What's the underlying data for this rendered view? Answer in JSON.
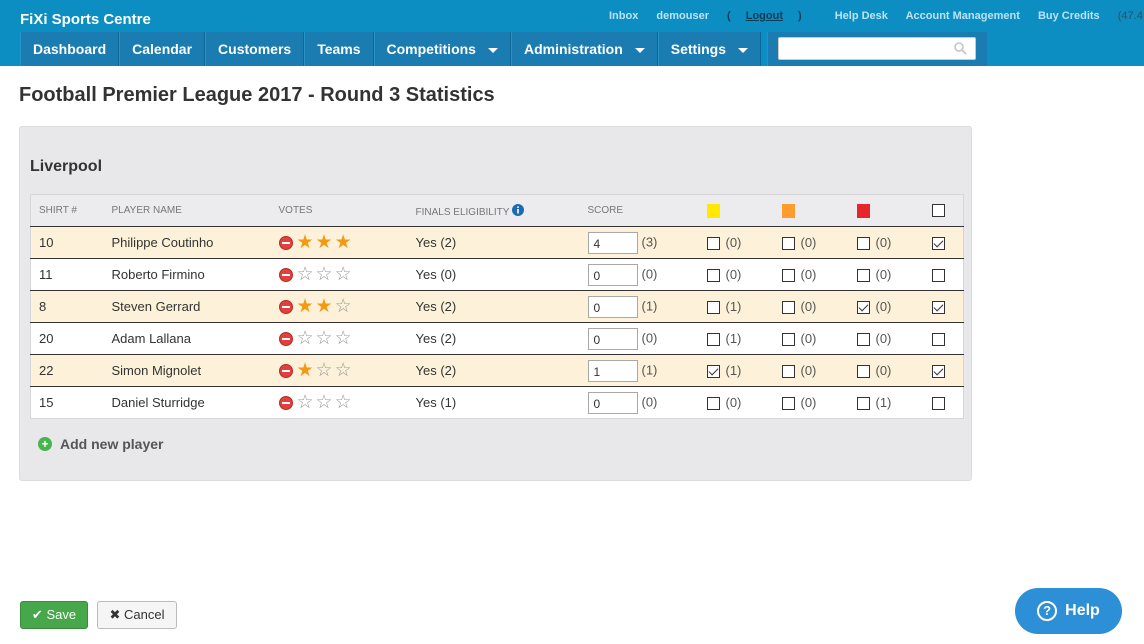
{
  "header": {
    "brand": "FiXi Sports Centre",
    "links": {
      "inbox": "Inbox",
      "user": "demouser",
      "logout": "Logout",
      "help_desk": "Help Desk",
      "account": "Account Management",
      "buy_credits": "Buy Credits",
      "credits_value": "47.4"
    },
    "nav": [
      "Dashboard",
      "Calendar",
      "Customers",
      "Teams",
      "Competitions",
      "Administration",
      "Settings"
    ],
    "search_placeholder": ""
  },
  "page_title": "Football Premier League 2017 - Round 3 Statistics",
  "team_name": "Liverpool",
  "table": {
    "headers": {
      "shirt": "SHIRT #",
      "name": "PLAYER NAME",
      "votes": "VOTES",
      "eligibility": "FINALS ELIGIBILITY",
      "score": "SCORE"
    },
    "card_colors": {
      "yellow": "#ffe900",
      "orange": "#ff9c2e",
      "red": "#e8262a"
    },
    "rows": [
      {
        "shirt": "10",
        "name": "Philippe Coutinho",
        "stars": 3,
        "eligibility": "Yes (2)",
        "score": "4",
        "score_count": "(3)",
        "yellow": false,
        "yellow_count": "(0)",
        "orange": false,
        "orange_count": "(0)",
        "red": false,
        "red_count": "(0)",
        "played": true
      },
      {
        "shirt": "11",
        "name": "Roberto Firmino",
        "stars": 0,
        "eligibility": "Yes (0)",
        "score": "0",
        "score_count": "(0)",
        "yellow": false,
        "yellow_count": "(0)",
        "orange": false,
        "orange_count": "(0)",
        "red": false,
        "red_count": "(0)",
        "played": false
      },
      {
        "shirt": "8",
        "name": "Steven Gerrard",
        "stars": 2,
        "eligibility": "Yes (2)",
        "score": "0",
        "score_count": "(1)",
        "yellow": false,
        "yellow_count": "(1)",
        "orange": false,
        "orange_count": "(0)",
        "red": true,
        "red_count": "(0)",
        "played": true
      },
      {
        "shirt": "20",
        "name": "Adam Lallana",
        "stars": 0,
        "eligibility": "Yes (2)",
        "score": "0",
        "score_count": "(0)",
        "yellow": false,
        "yellow_count": "(1)",
        "orange": false,
        "orange_count": "(0)",
        "red": false,
        "red_count": "(0)",
        "played": false
      },
      {
        "shirt": "22",
        "name": "Simon Mignolet",
        "stars": 1,
        "eligibility": "Yes (2)",
        "score": "1",
        "score_count": "(1)",
        "yellow": true,
        "yellow_count": "(1)",
        "orange": false,
        "orange_count": "(0)",
        "red": false,
        "red_count": "(0)",
        "played": true
      },
      {
        "shirt": "15",
        "name": "Daniel Sturridge",
        "stars": 0,
        "eligibility": "Yes (1)",
        "score": "0",
        "score_count": "(0)",
        "yellow": false,
        "yellow_count": "(0)",
        "orange": false,
        "orange_count": "(0)",
        "red": false,
        "red_count": "(1)",
        "played": false
      }
    ]
  },
  "add_player": "Add new player",
  "buttons": {
    "save": "Save",
    "cancel": "Cancel",
    "help": "Help"
  }
}
